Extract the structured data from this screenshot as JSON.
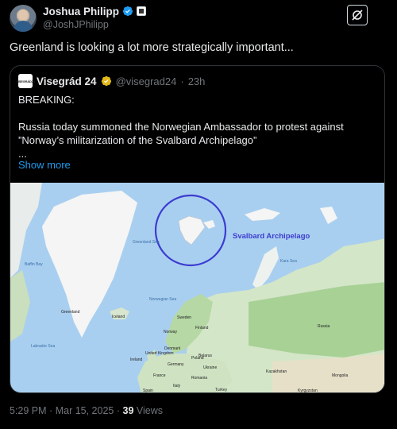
{
  "author": {
    "name": "Joshua Philipp",
    "handle": "@JoshJPhilipp"
  },
  "tweet": {
    "text": "Greenland is looking a lot more strategically important..."
  },
  "quote": {
    "author_name": "Visegrád 24",
    "handle": "@visegrad24",
    "separator": "·",
    "time": "23h",
    "avatar_text": "VISEGRÁD24",
    "body": "BREAKING:\n\nRussia today summoned the Norwegian Ambassador to protest against ”Norway’s militarization of the Svalbard Archipelago”\n...",
    "show_more": "Show more"
  },
  "map": {
    "highlight_label": "Svalbard Archipelago",
    "labels": {
      "greenland": "Greenland",
      "iceland": "Iceland",
      "norway": "Norway",
      "sweden": "Sweden",
      "finland": "Finland",
      "russia": "Russia",
      "kazakhstan": "Kazakhstan",
      "mongolia": "Mongolia",
      "uk": "United Kingdom",
      "ireland": "Ireland",
      "france": "France",
      "spain": "Spain",
      "germany": "Germany",
      "poland": "Poland",
      "ukraine": "Ukraine",
      "italy": "Italy",
      "belarus": "Belarus",
      "romania": "Romania",
      "denmark": "Denmark",
      "turkey": "Turkey",
      "kyrgyzstan": "Kyrgyzstan",
      "greenland_sea": "Greenland Sea",
      "norwegian_sea": "Norwegian Sea",
      "kara_sea": "Kara Sea",
      "baffin_bay": "Baffin Bay",
      "labrador_sea": "Labrador Sea"
    },
    "colors": {
      "water": "#a9cff0",
      "land": "#d4e6c8",
      "green": "#9fcf8f",
      "ice": "#f5f5f5",
      "circle": "#3c3cd0"
    }
  },
  "footer": {
    "time": "5:29 PM",
    "separator": "·",
    "date": "Mar 15, 2025",
    "views_count": "39",
    "views_label": "Views"
  }
}
